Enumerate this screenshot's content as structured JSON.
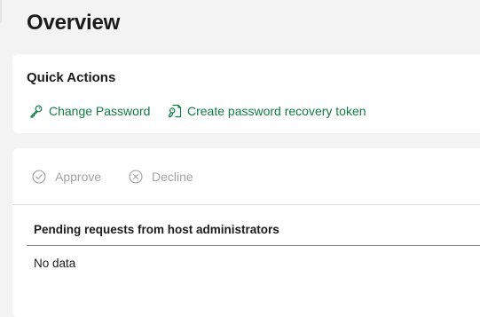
{
  "page": {
    "title": "Overview"
  },
  "quick_actions": {
    "title": "Quick Actions",
    "change_password": {
      "label": "Change Password",
      "icon": "key-icon"
    },
    "recovery_token": {
      "label": "Create password recovery token",
      "icon": "key-document-icon"
    },
    "link_color": "#107c41"
  },
  "requests": {
    "toolbar": {
      "approve": {
        "label": "Approve",
        "icon": "check-circle-icon",
        "enabled": false
      },
      "decline": {
        "label": "Decline",
        "icon": "x-circle-icon",
        "enabled": false
      }
    },
    "table": {
      "column_header": "Pending requests from host administrators",
      "empty_text": "No data"
    }
  },
  "colors": {
    "background": "#f3f3f3",
    "card": "#ffffff",
    "disabled": "#a3a3a3"
  }
}
